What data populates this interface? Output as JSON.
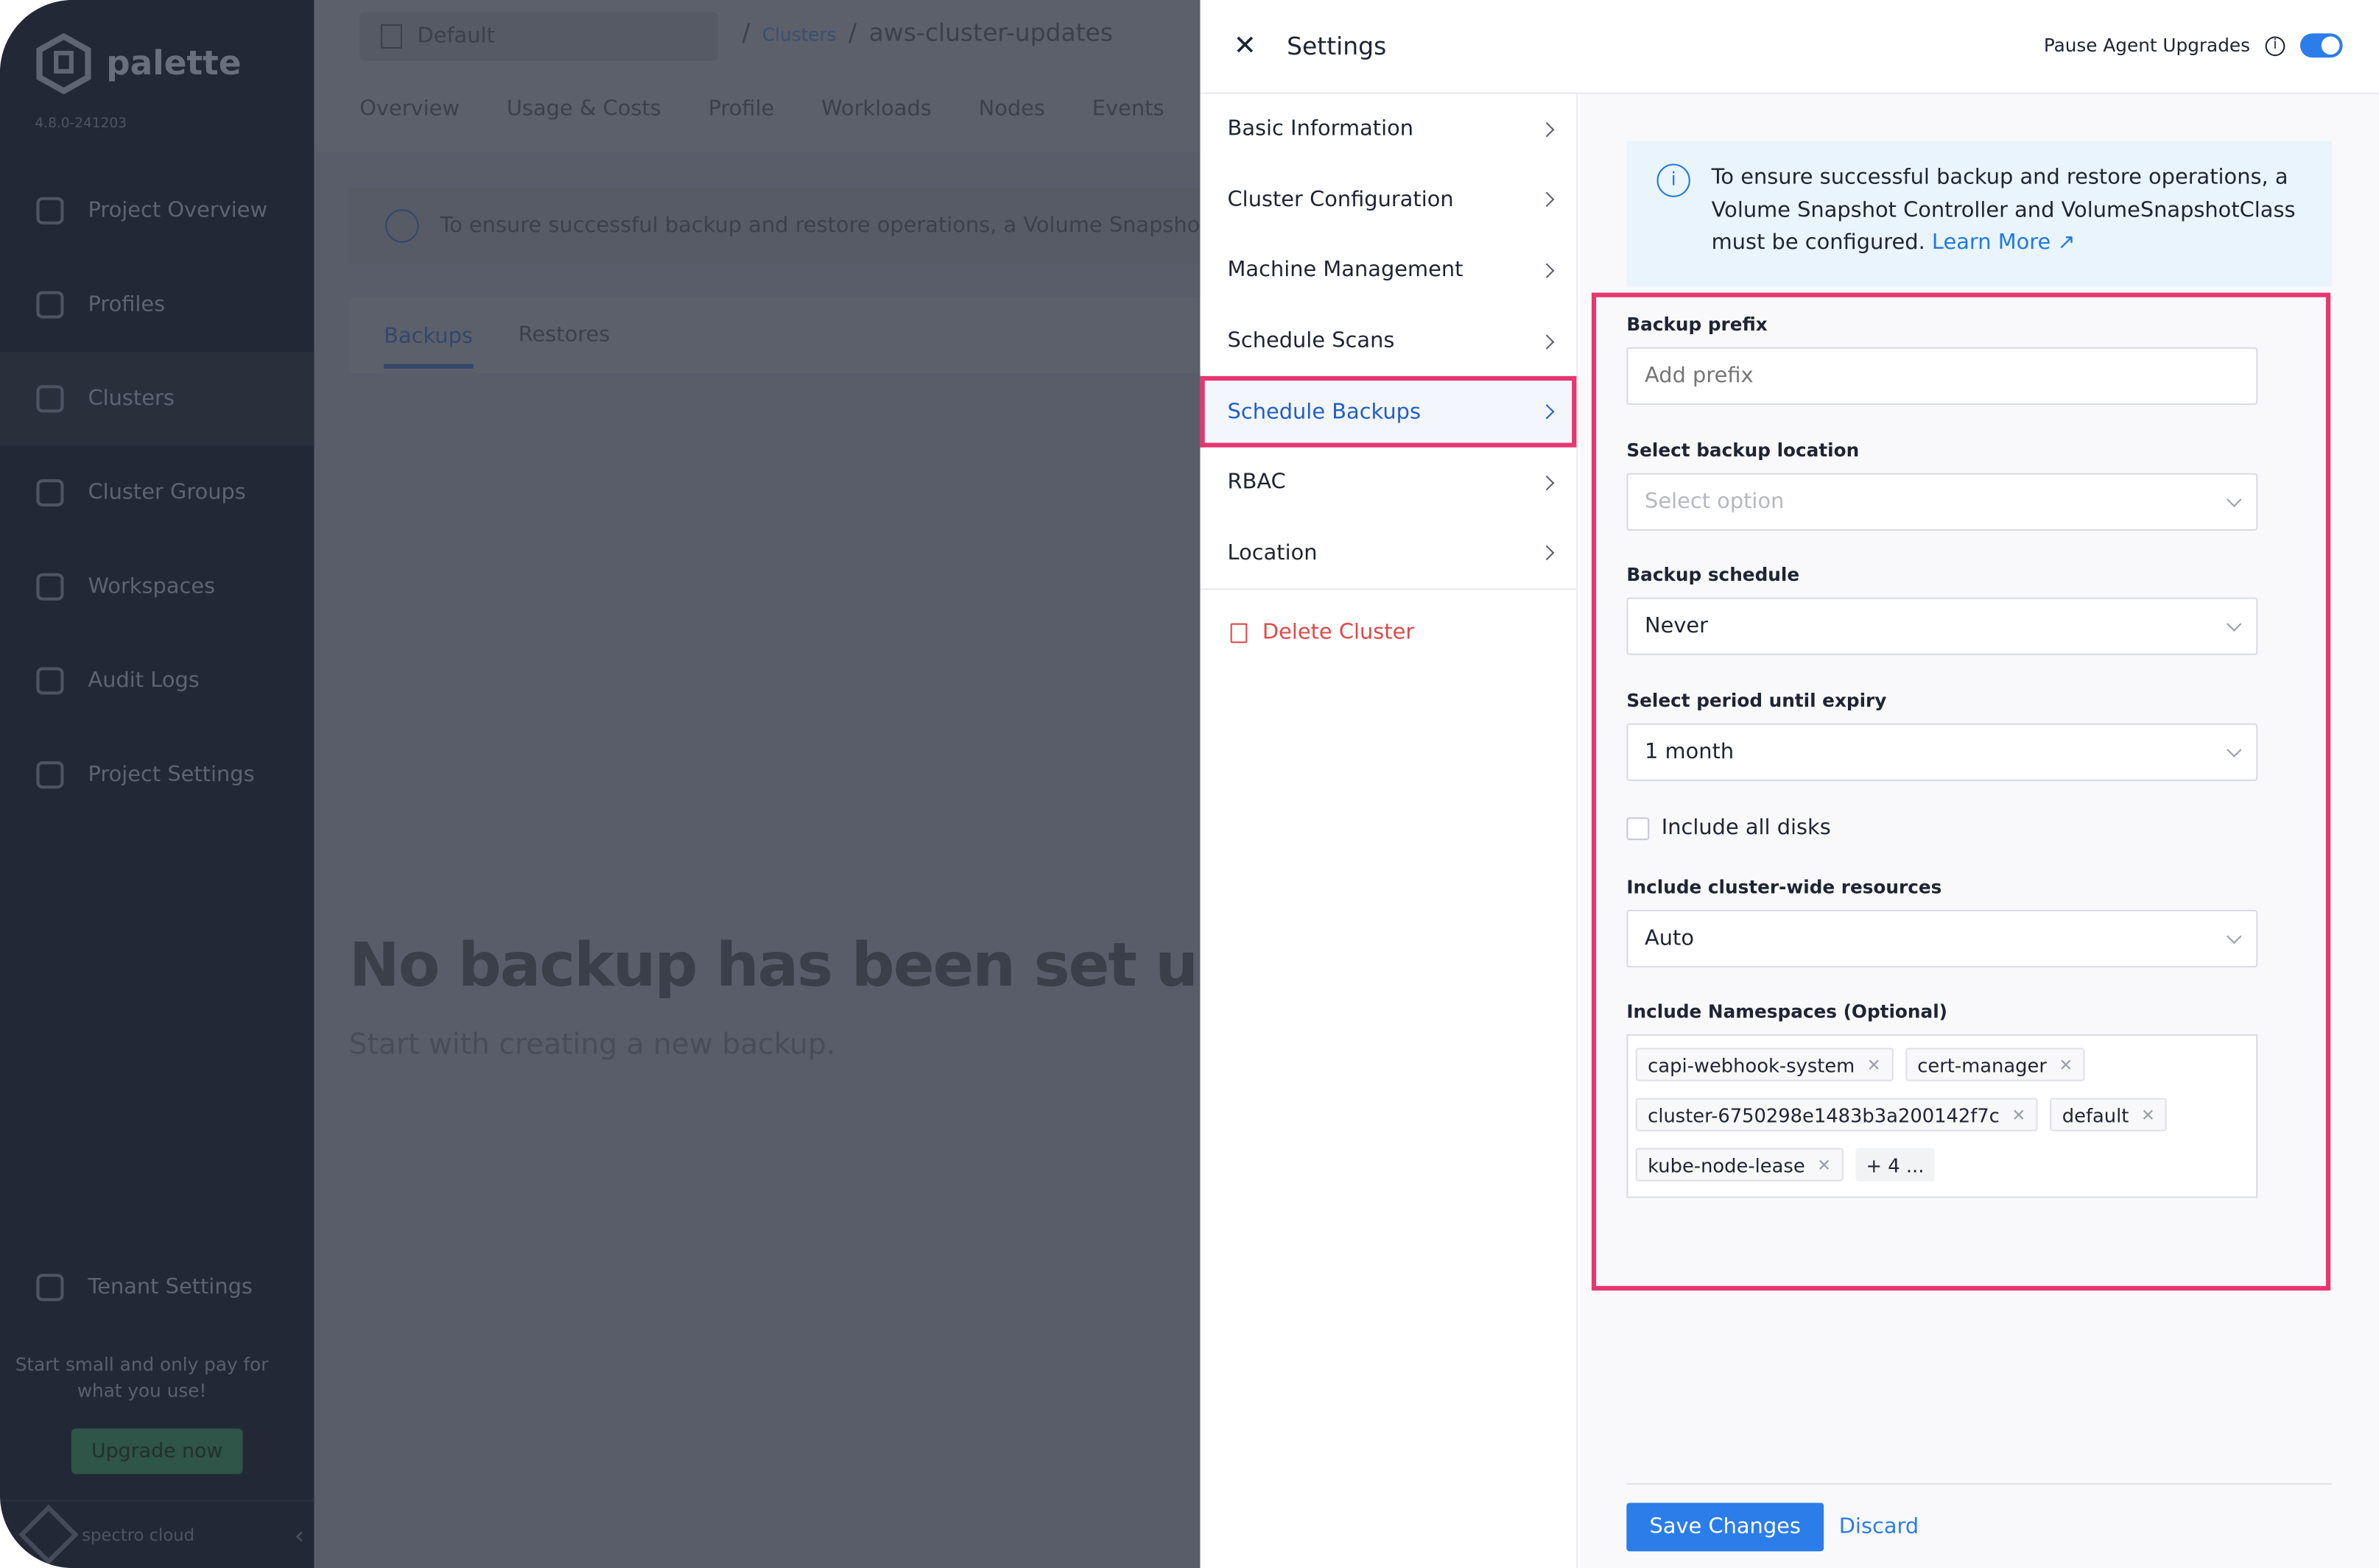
{
  "app": {
    "name": "palette",
    "version": "4.8.0-241203"
  },
  "sidebar": {
    "items": [
      {
        "label": "Project Overview",
        "icon": "chart-icon"
      },
      {
        "label": "Profiles",
        "icon": "database-icon"
      },
      {
        "label": "Clusters",
        "icon": "list-icon",
        "active": true
      },
      {
        "label": "Cluster Groups",
        "icon": "network-icon"
      },
      {
        "label": "Workspaces",
        "icon": "target-icon"
      },
      {
        "label": "Audit Logs",
        "icon": "file-search-icon"
      },
      {
        "label": "Project Settings",
        "icon": "gear-icon"
      }
    ],
    "tenant": "Tenant Settings",
    "promo": "Start small and only pay for what you use!",
    "upgrade": "Upgrade now",
    "footer_brand": "spectro cloud"
  },
  "header": {
    "project": "Default",
    "breadcrumb": {
      "parent": "Clusters",
      "current": "aws-cluster-updates"
    },
    "tabs": [
      "Overview",
      "Usage & Costs",
      "Profile",
      "Workloads",
      "Nodes",
      "Events"
    ]
  },
  "main": {
    "info": "To ensure successful backup and restore operations, a Volume Snapshot C",
    "subtabs": [
      "Backups",
      "Restores"
    ],
    "empty_title": "No backup has been set up y",
    "empty_sub": "Start with creating a new backup."
  },
  "drawer": {
    "title": "Settings",
    "pause_label": "Pause Agent Upgrades",
    "pause_enabled": true,
    "menu": [
      "Basic Information",
      "Cluster Configuration",
      "Machine Management",
      "Schedule Scans",
      "Schedule Backups",
      "RBAC",
      "Location"
    ],
    "selected": "Schedule Backups",
    "delete": "Delete Cluster",
    "note": "To ensure successful backup and restore operations, a Volume Snapshot Controller and VolumeSnapshotClass must be configured.",
    "learn_more": "Learn More",
    "form": {
      "prefix_label": "Backup prefix",
      "prefix_placeholder": "Add prefix",
      "location_label": "Select backup location",
      "location_placeholder": "Select option",
      "schedule_label": "Backup schedule",
      "schedule_value": "Never",
      "expiry_label": "Select period until expiry",
      "expiry_value": "1 month",
      "disks_label": "Include all disks",
      "disks_checked": false,
      "cluster_label": "Include cluster-wide resources",
      "cluster_value": "Auto",
      "ns_label": "Include Namespaces (Optional)",
      "namespaces": [
        "capi-webhook-system",
        "cert-manager",
        "cluster-6750298e1483b3a200142f7c",
        "default",
        "kube-node-lease"
      ],
      "ns_more": "+ 4 ..."
    },
    "save": "Save Changes",
    "discard": "Discard"
  },
  "colors": {
    "accent": "#2b7de9",
    "highlight": "#e8356f",
    "danger": "#e04848"
  }
}
